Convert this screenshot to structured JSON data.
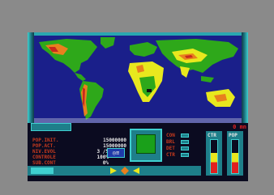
{
  "status": {
    "time_label": "0 mn"
  },
  "stats": {
    "labels": [
      "POP.INIT.",
      "POP.ACT.",
      "NIV.EVOL",
      "CONTROLE",
      "SUB.CONT"
    ],
    "values": [
      "15000000",
      "15000000",
      "3 /5",
      "100%",
      "0%"
    ]
  },
  "options": {
    "labels": [
      "CON",
      "BRL",
      "DET",
      "CTR"
    ]
  },
  "gauges": {
    "ctr_label": "CTR",
    "pop_label": "POP",
    "ctr_level": 0.62,
    "pop_level": 0.62
  },
  "eye_label": "◎≡",
  "colors": {
    "ocean": "#1a1f8a",
    "land_green": "#2ea81a",
    "land_yellow": "#e8e81e",
    "land_orange": "#e8801e",
    "land_red": "#c82a1e",
    "accent": "#3fd0d0"
  }
}
